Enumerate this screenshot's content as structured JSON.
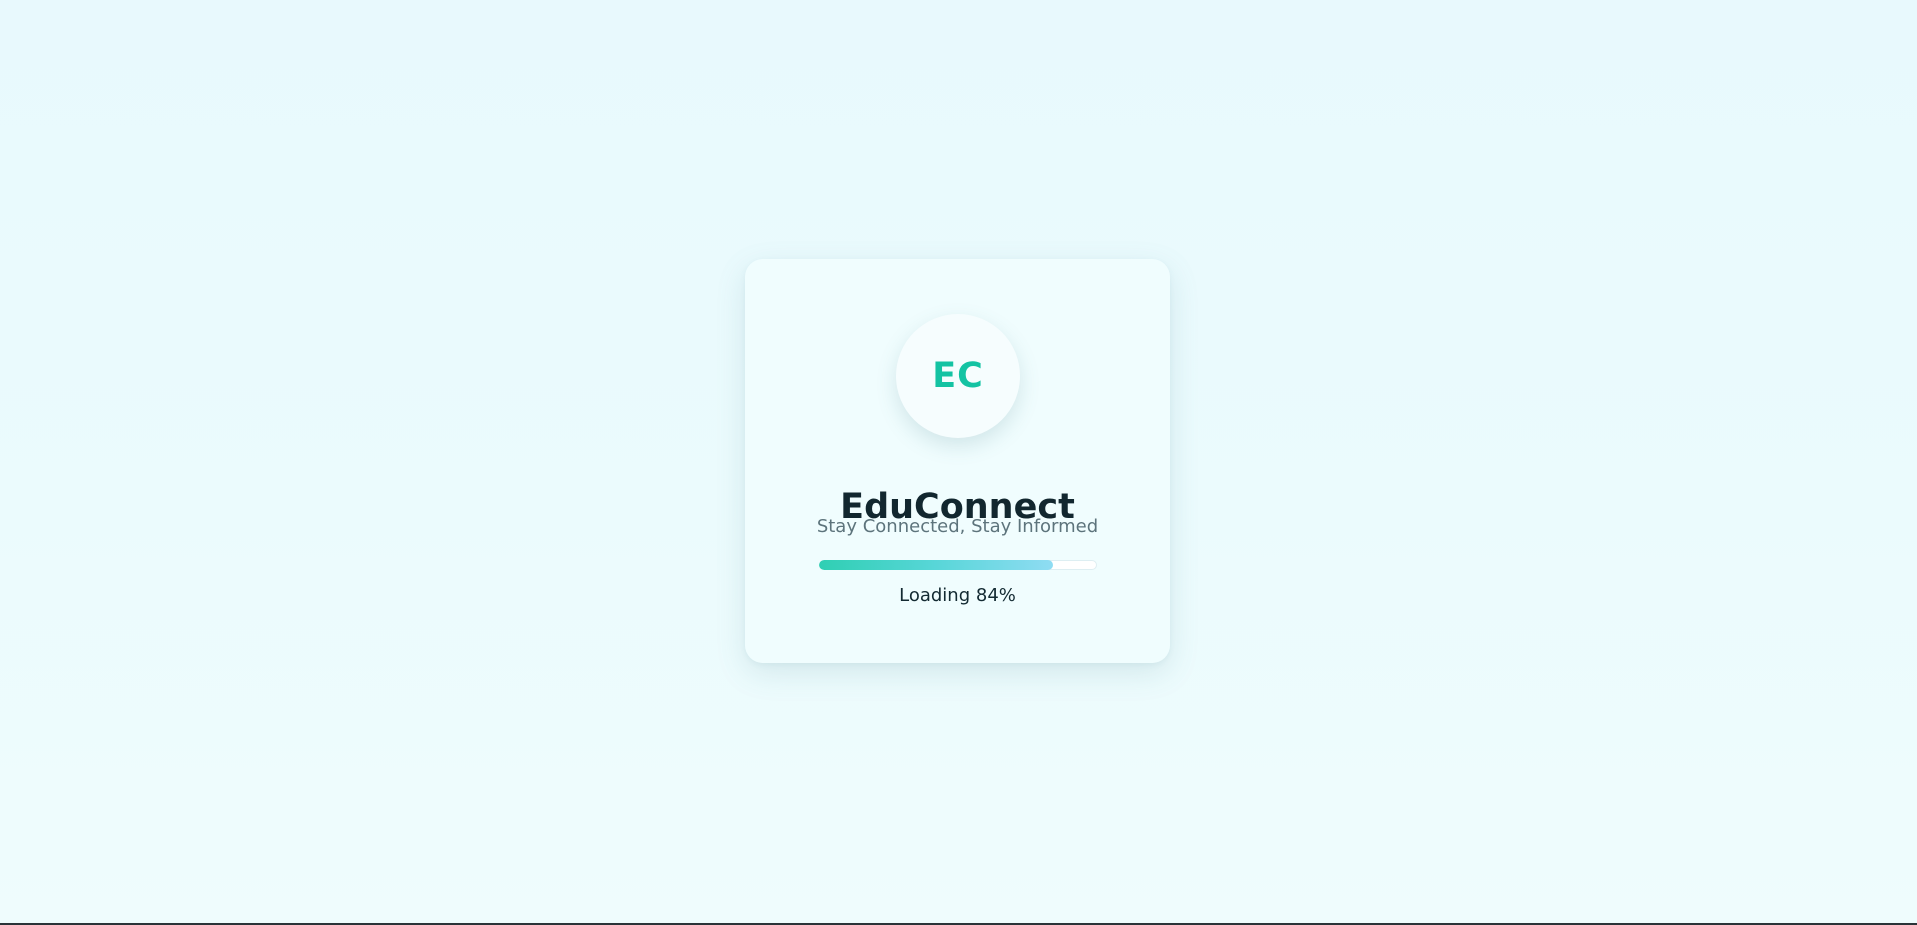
{
  "splash": {
    "logo_initials": "EC",
    "title": "EduConnect",
    "tagline": "Stay Connected, Stay Informed",
    "progress": {
      "percent": 84,
      "label": "Loading 84%"
    }
  },
  "colors": {
    "background": "#e9fafc",
    "card": "#f0fdfe",
    "accent": "#14c3a3",
    "title": "#12272f",
    "tagline": "#5d747c",
    "progress_start": "#2fcfb3",
    "progress_end": "#8fdcf3"
  }
}
